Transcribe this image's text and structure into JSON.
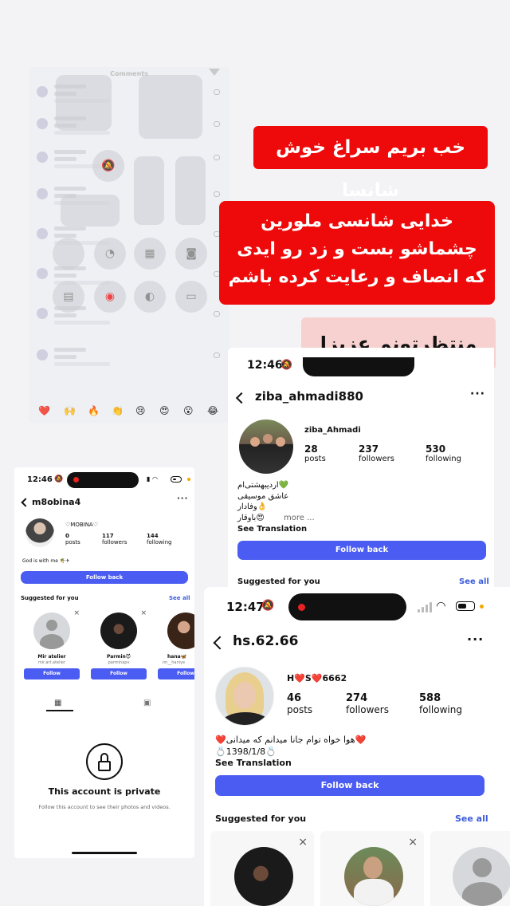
{
  "comments_panel": {
    "title": "Comments",
    "emojis": [
      "❤️",
      "🙌",
      "🔥",
      "👏",
      "😢",
      "😍",
      "😮",
      "😂"
    ]
  },
  "banners": {
    "b1": "خب بریم سراغ خوش شانسا",
    "b2": [
      "خدایی شانسی ملورین",
      "چشماشو بست و زد رو ایدی",
      "که انصاف و رعایت کرده باشم"
    ],
    "b3": "منتظرتونم عزیزا"
  },
  "card_small": {
    "time": "12:46",
    "username": "m8obina4",
    "name": "♡MOBINA♡",
    "stats": [
      {
        "n": "0",
        "l": "posts"
      },
      {
        "n": "117",
        "l": "followers"
      },
      {
        "n": "144",
        "l": "following"
      }
    ],
    "bio": "God is with me 🌴✈",
    "follow_back": "Follow back",
    "suggested": "Suggested for you",
    "see_all": "See all",
    "suggestions": [
      {
        "name": "Mir atelier",
        "handle": "mir.art.atelier",
        "btn": "Follow"
      },
      {
        "name": "Parmin😈",
        "handle": "parminapv",
        "btn": "Follow"
      },
      {
        "name": "hana🦋",
        "handle": "im__haniye",
        "btn": "Follow"
      }
    ],
    "private_title": "This account is private",
    "private_sub": "Follow this account to see their photos and videos."
  },
  "card_mid": {
    "time": "12:46",
    "username": "ziba_ahmadi880",
    "name": "ziba_Ahmadi",
    "stats": [
      {
        "n": "28",
        "l": "posts"
      },
      {
        "n": "237",
        "l": "followers"
      },
      {
        "n": "530",
        "l": "following"
      }
    ],
    "bio": [
      "💚اردیبهشتی‌ام",
      "عاشق موسیقی",
      "👌وفادار",
      "😍باوقار"
    ],
    "more": "more ...",
    "see_translation": "See Translation",
    "follow_back": "Follow back",
    "suggested": "Suggested for you",
    "see_all": "See all"
  },
  "card_big": {
    "time": "12:47",
    "username": "hs.62.66",
    "name": "H❤️S❤️6662",
    "stats": [
      {
        "n": "46",
        "l": "posts"
      },
      {
        "n": "274",
        "l": "followers"
      },
      {
        "n": "588",
        "l": "following"
      }
    ],
    "bio": [
      "❤️هوا خواه توام جانا میدانم که میدانی❤️",
      "💍1398/1/8💍"
    ],
    "see_translation": "See Translation",
    "follow_back": "Follow back",
    "suggested": "Suggested for you",
    "see_all": "See all"
  },
  "colors": {
    "red_banner": "#ee0a0a",
    "pink_banner": "#f7d1cf",
    "follow_blue": "#4a5cf2",
    "link_blue": "#3b5bdb"
  }
}
